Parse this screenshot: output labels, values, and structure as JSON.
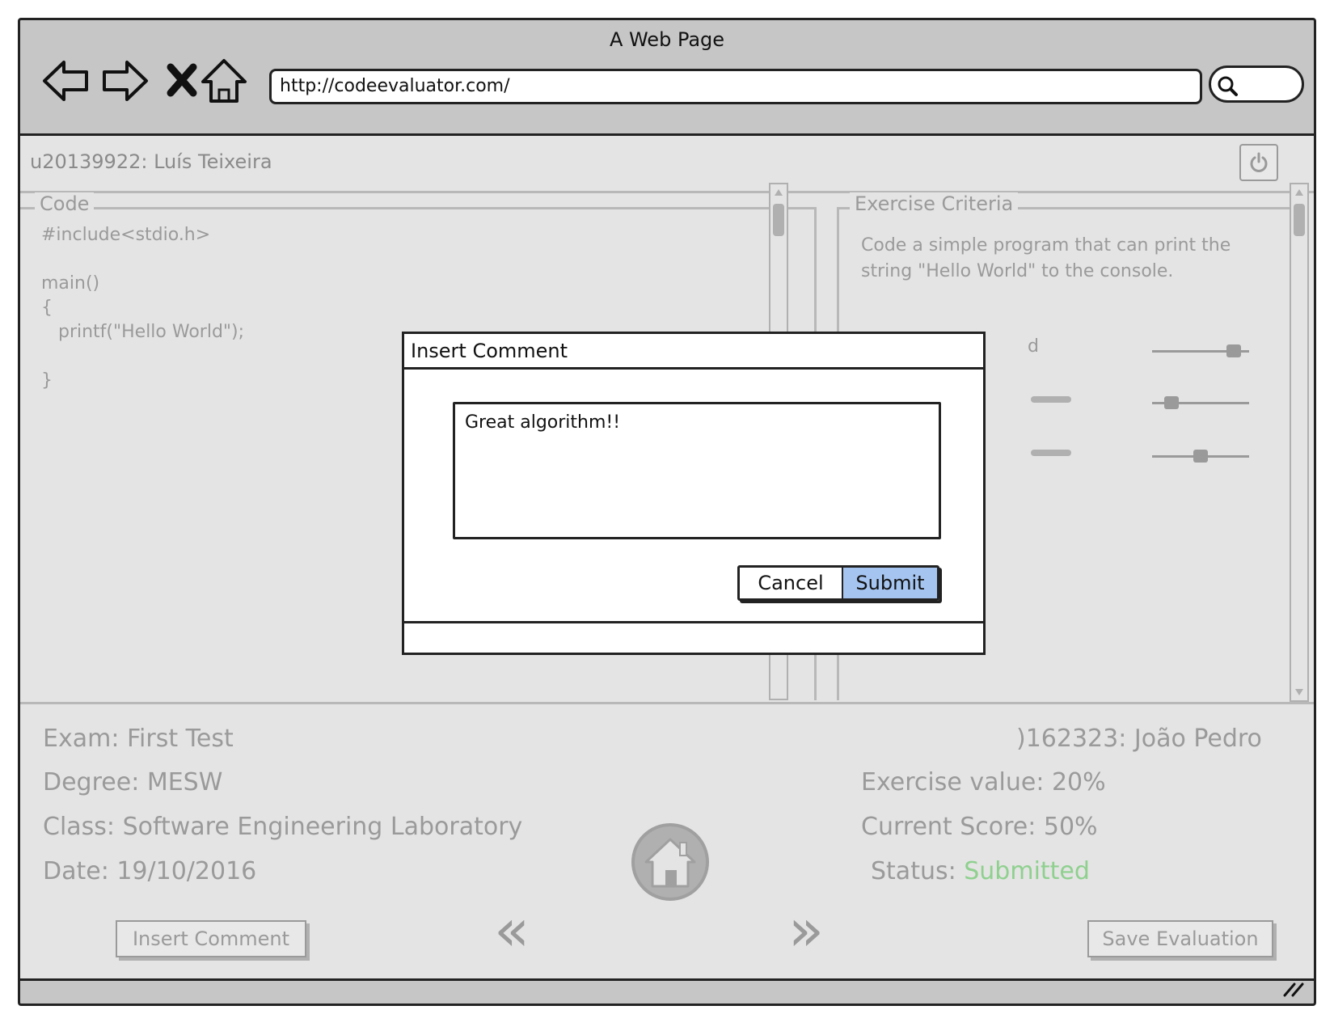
{
  "window": {
    "title": "A Web Page"
  },
  "toolbar": {
    "url": "http://codeevaluator.com/"
  },
  "page": {
    "user": "u20139922: Luís Teixeira",
    "code_panel": {
      "legend": "Code",
      "lines": [
        "#include<stdio.h>",
        "",
        "main()",
        "{",
        "   printf(\"Hello World\");",
        "",
        "}"
      ]
    },
    "criteria_panel": {
      "legend": "Exercise Criteria",
      "description": "Code a simple program that can print the string \"Hello World\" to the console.",
      "criteria": [
        {
          "label_visible": "d",
          "level": 0.9
        },
        {
          "label_visible": "",
          "level": 0.15
        },
        {
          "label_visible": "",
          "level": 0.5
        }
      ]
    },
    "info_left": {
      "exam": "Exam: First Test",
      "degree": "Degree: MESW",
      "class": "Class: Software Engineering Laboratory",
      "date": "Date: 19/10/2016"
    },
    "info_right": {
      "student": ")162323: João Pedro",
      "exercise_value": "Exercise value: 20%",
      "current_score": "Current Score: 50%",
      "status_label": "Status:",
      "status_value": "Submitted",
      "status_color": "#8fd08f"
    },
    "actions": {
      "insert_comment": "Insert Comment",
      "prev": "«",
      "next": "»",
      "save_evaluation": "Save Evaluation"
    }
  },
  "modal": {
    "title": "Insert Comment",
    "comment_value": "Great algorithm!!",
    "cancel_label": "Cancel",
    "submit_label": "Submit",
    "submit_color": "#a5c4f0"
  }
}
